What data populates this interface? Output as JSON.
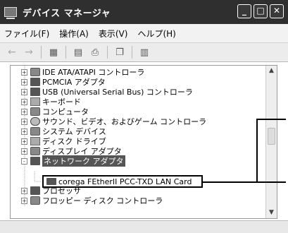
{
  "window": {
    "title": "デバイス マネージャ",
    "buttons": [
      "_",
      "□",
      "✕"
    ]
  },
  "menu": [
    "ファイル(F)",
    "操作(A)",
    "表示(V)",
    "ヘルプ(H)"
  ],
  "toolbar": {
    "back": "←",
    "forward": "→",
    "icons": [
      "▦",
      "▤",
      "⎙",
      "❐",
      "▥"
    ]
  },
  "tree": {
    "items": [
      {
        "label": "IDE ATA/ATAPI コントローラ",
        "icon": "disk-controller-icon",
        "expander": "+"
      },
      {
        "label": "PCMCIA アダプタ",
        "icon": "pcmcia-icon",
        "expander": "+"
      },
      {
        "label": "USB (Universal Serial Bus) コントローラ",
        "icon": "usb-icon",
        "expander": "+"
      },
      {
        "label": "キーボード",
        "icon": "keyboard-icon",
        "expander": "+"
      },
      {
        "label": "コンピュータ",
        "icon": "computer-icon",
        "expander": "+"
      },
      {
        "label": "サウンド、ビデオ、およびゲーム コントローラ",
        "icon": "sound-icon",
        "expander": "+"
      },
      {
        "label": "システム デバイス",
        "icon": "system-icon",
        "expander": "+"
      },
      {
        "label": "ディスク ドライブ",
        "icon": "disk-icon",
        "expander": "+"
      },
      {
        "label": "ディスプレイ アダプタ",
        "icon": "display-icon",
        "expander": "+"
      },
      {
        "label": "ネットワーク アダプタ",
        "icon": "network-icon",
        "expander": "-"
      },
      {
        "label": "corega FEtherII PCC-TXD LAN Card",
        "icon": "lan-card-icon",
        "expander": ""
      },
      {
        "label": "プロセッサ",
        "icon": "processor-icon",
        "expander": "+"
      },
      {
        "label": "フロッピー ディスク コントローラ",
        "icon": "floppy-controller-icon",
        "expander": "+"
      }
    ]
  }
}
